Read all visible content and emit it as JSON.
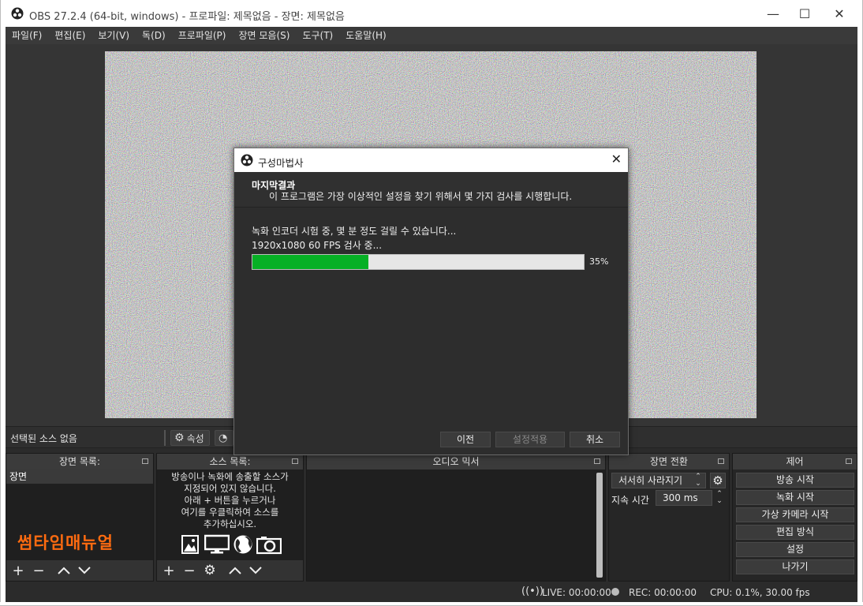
{
  "window": {
    "title": "OBS 27.2.4 (64-bit, windows) - 프로파일: 제목없음 - 장면: 제목없음",
    "minimize": "—",
    "maximize": "☐",
    "close": "✕"
  },
  "menu": [
    "파일(F)",
    "편집(E)",
    "보기(V)",
    "독(D)",
    "프로파일(P)",
    "장면 모음(S)",
    "도구(T)",
    "도움말(H)"
  ],
  "context_bar": {
    "no_source": "선택된 소스 없음",
    "properties": "속성"
  },
  "docks": {
    "scenes": {
      "header": "장면 목록:",
      "items": [
        "장면"
      ],
      "watermark": "썸타임매뉴얼"
    },
    "sources": {
      "header": "소스 목록:",
      "hint": "방송이나 녹화에 송출할 소스가\n지정되어 있지 않습니다.\n아래 + 버튼을 누르거나\n여기를 우클릭하여 소스를\n추가하십시오."
    },
    "mixer": {
      "header": "오디오 믹서"
    },
    "transitions": {
      "header": "장면 전환",
      "selected": "서서히 사라지기",
      "duration_label": "지속 시간",
      "duration_value": "300 ms"
    },
    "controls": {
      "header": "제어",
      "buttons": [
        "방송 시작",
        "녹화 시작",
        "가상 카메라 시작",
        "편집 방식",
        "설정",
        "나가기"
      ]
    }
  },
  "status": {
    "live": "LIVE: 00:00:00",
    "rec": "REC: 00:00:00",
    "cpu": "CPU: 0.1%, 30.00 fps"
  },
  "dialog": {
    "title": "구성마법사",
    "close": "✕",
    "heading": "마지막결과",
    "subheading": "이 프로그램은 가장 이상적인 설정을 찾기 위해서 몇 가지 검사를 시행합니다.",
    "status_line1": "녹화 인코더 시험 중, 몇 분 정도 걸릴 수 있습니다...",
    "status_line2": "1920x1080 60 FPS 검사 중...",
    "progress": 0.35,
    "progress_label": "35%",
    "buttons": {
      "back": "이전",
      "apply": "설정적용",
      "cancel": "취소"
    }
  },
  "colors": {
    "progress_fill": "#06b025",
    "watermark": "#ff6b10",
    "panel_bg": "#2b2b2b"
  }
}
